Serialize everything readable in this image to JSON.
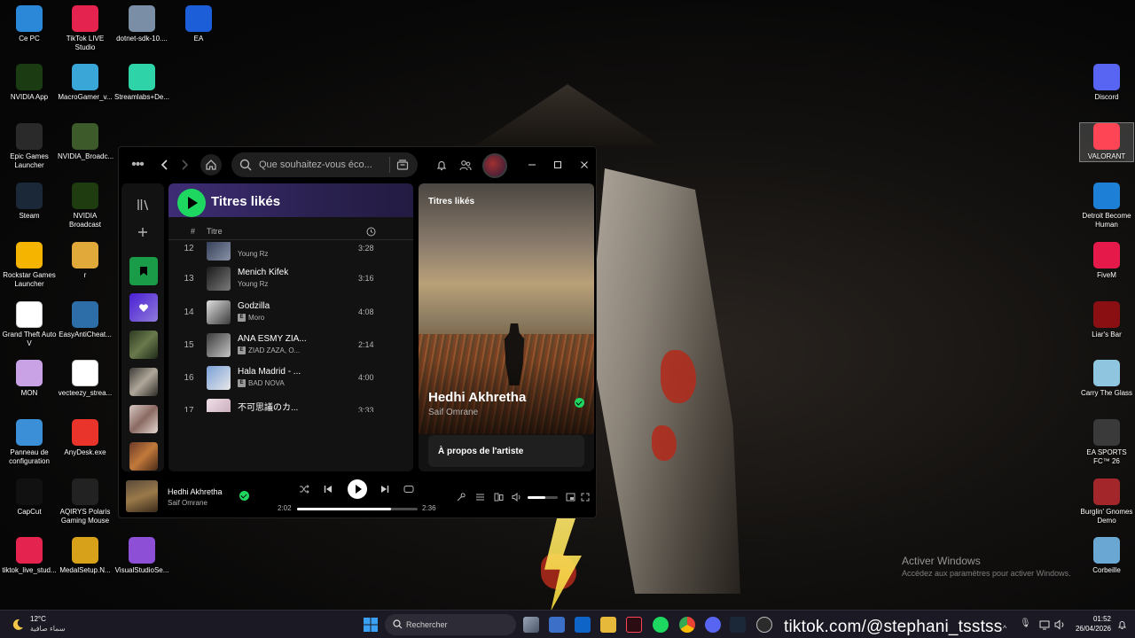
{
  "desktop": {
    "left_icons": [
      {
        "label": "Ce PC",
        "icon": "computer-icon",
        "color": "#2b88d8"
      },
      {
        "label": "TikTok LIVE Studio",
        "icon": "tiktok-icon",
        "color": "#e4234f"
      },
      {
        "label": "dotnet-sdk-10....",
        "icon": "installer-icon",
        "color": "#7a8fa6"
      },
      {
        "label": "EA",
        "icon": "ea-icon",
        "color": "#1c5dd8"
      },
      {
        "label": "NVIDIA App",
        "icon": "nvidia-icon",
        "color": "#1b3b12"
      },
      {
        "label": "MacroGamer_v...",
        "icon": "disc-icon",
        "color": "#3aa6d8"
      },
      {
        "label": "Streamlabs+De...",
        "icon": "streamlabs-icon",
        "color": "#2ed3a7"
      },
      {
        "label": "Epic Games Launcher",
        "icon": "epic-icon",
        "color": "#2a2a2a"
      },
      {
        "label": "NVIDIA_Broadc...",
        "icon": "nvidia-icon",
        "color": "#3c5a2a"
      },
      {
        "label": "Steam",
        "icon": "steam-icon",
        "color": "#1b2838"
      },
      {
        "label": "NVIDIA Broadcast",
        "icon": "broadcast-icon",
        "color": "#1f3b10"
      },
      {
        "label": "Rockstar Games Launcher",
        "icon": "rockstar-icon",
        "color": "#f5b400"
      },
      {
        "label": "r",
        "icon": "folder-icon",
        "color": "#e1a93a"
      },
      {
        "label": "Grand Theft Auto V",
        "icon": "file-icon",
        "color": "#ffffff"
      },
      {
        "label": "EasyAntiCheat...",
        "icon": "eac-icon",
        "color": "#2d6ea8"
      },
      {
        "label": "MON",
        "icon": "image-icon",
        "color": "#c9a2e6"
      },
      {
        "label": "vecteezy_strea...",
        "icon": "video-icon",
        "color": "#ffffff"
      },
      {
        "label": "Panneau de configuration",
        "icon": "control-panel-icon",
        "color": "#3b8fd6"
      },
      {
        "label": "AnyDesk.exe",
        "icon": "anydesk-icon",
        "color": "#e8342b"
      },
      {
        "label": "CapCut",
        "icon": "capcut-icon",
        "color": "#111111"
      },
      {
        "label": "AQIRYS Polaris Gaming Mouse",
        "icon": "mouse-icon",
        "color": "#222222"
      },
      {
        "label": "tiktok_live_stud...",
        "icon": "tiktok-icon",
        "color": "#e4234f"
      },
      {
        "label": "MedalSetup.N...",
        "icon": "medal-icon",
        "color": "#d7a21a"
      },
      {
        "label": "VisualStudioSe...",
        "icon": "visual-studio-icon",
        "color": "#8c4fd6"
      }
    ],
    "right_icons": [
      {
        "label": "Discord",
        "icon": "discord-icon",
        "color": "#5865f2"
      },
      {
        "label": "VALORANT",
        "icon": "valorant-icon",
        "color": "#fd4556"
      },
      {
        "label": "Detroit Become Human",
        "icon": "detroit-icon",
        "color": "#1d7fd6"
      },
      {
        "label": "FiveM",
        "icon": "fivem-icon",
        "color": "#e5194a"
      },
      {
        "label": "Liar's Bar",
        "icon": "liars-bar-icon",
        "color": "#8a0f12"
      },
      {
        "label": "Carry The Glass",
        "icon": "glass-icon",
        "color": "#8fc5de"
      },
      {
        "label": "EA SPORTS FC™ 26",
        "icon": "fc26-icon",
        "color": "#3a3a3a"
      },
      {
        "label": "Burglin' Gnomes Demo",
        "icon": "gnome-icon",
        "color": "#a3272a"
      },
      {
        "label": "Corbeille",
        "icon": "recycle-bin-icon",
        "color": "#6aa7d3"
      }
    ]
  },
  "spotify": {
    "search_placeholder": "Que souhaitez-vous éco...",
    "playlist_title": "Titres likés",
    "col_number": "#",
    "col_title": "Titre",
    "tracks": [
      {
        "num": "12",
        "title": "",
        "artist": "Young Rz",
        "duration": "3:28",
        "explicit": false
      },
      {
        "num": "13",
        "title": "Menich Kifek",
        "artist": "Young Rz",
        "duration": "3:16",
        "explicit": false
      },
      {
        "num": "14",
        "title": "Godzilla",
        "artist": "Moro",
        "duration": "4:08",
        "explicit": true
      },
      {
        "num": "15",
        "title": "ANA ESMY ZIA...",
        "artist": "ZIAD ZAZA, O...",
        "duration": "2:14",
        "explicit": true
      },
      {
        "num": "16",
        "title": "Hala Madrid - ...",
        "artist": "BAD NOVA",
        "duration": "4:00",
        "explicit": true
      },
      {
        "num": "17",
        "title": "不可思議のカ...",
        "artist": "",
        "duration": "3:33",
        "explicit": false
      }
    ],
    "right_panel": {
      "label": "Titres likés",
      "song": "Hedhi Akhretha",
      "artist": "Saif Omrane",
      "about": "À propos de l'artiste"
    },
    "now_playing": {
      "title": "Hedhi Akhretha",
      "artist": "Saif Omrane",
      "elapsed": "2:02",
      "total": "2:36",
      "progress": 0.78,
      "volume": 0.6
    },
    "accent": "#1ed760"
  },
  "watermark": {
    "title": "Activer Windows",
    "subtitle": "Accédez aux paramètres pour activer Windows."
  },
  "taskbar": {
    "weather_temp": "12°C",
    "weather_desc": "سماء صافية",
    "search_label": "Rechercher",
    "time": "01:52",
    "date": "26/04/2026"
  },
  "overlay_text": "tiktok.com/@stephani_tsstss"
}
